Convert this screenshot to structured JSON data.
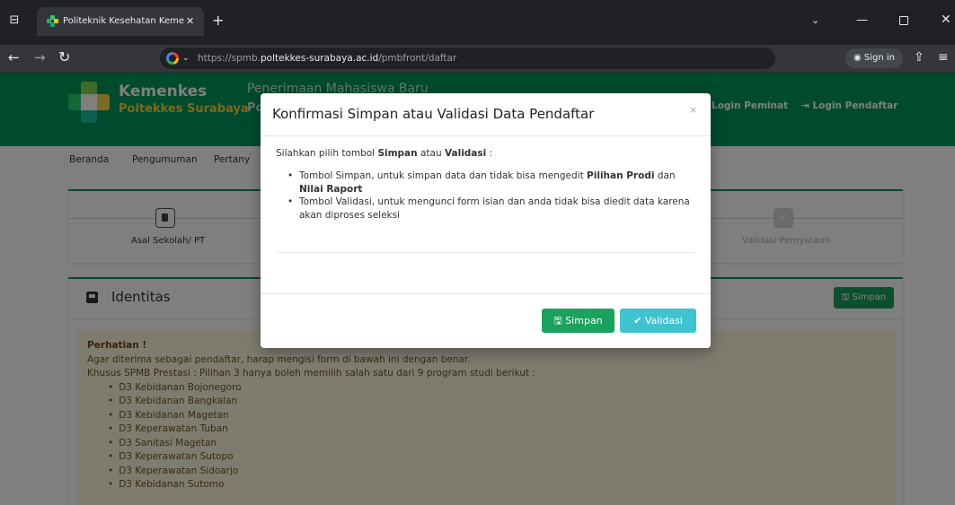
{
  "browser": {
    "tab_title": "Politeknik Kesehatan Kemenkes",
    "tab_close": "✕",
    "new_tab": "+",
    "url_prefix": "https://spmb.",
    "url_domain": "poltekkes-surabaya.ac.id",
    "url_path": "/pmbfront/daftar",
    "signin_label": "Sign in",
    "icons": [
      "tab-search-icon",
      "favicon-icon",
      "close-icon",
      "plus-icon",
      "chevron-down-icon",
      "minimize-icon",
      "maximize-icon",
      "close-window-icon",
      "back-arrow-icon",
      "forward-arrow-icon",
      "reload-icon",
      "google-icon",
      "user-icon",
      "share-icon",
      "menu-icon"
    ]
  },
  "header": {
    "brand_line1": "Kemenkes",
    "brand_line2": "Poltekkes Surabaya",
    "title_line1": "Penerimaan Mahasiswa Baru",
    "title_line2": "Po",
    "login_peminat": "Login Peminat",
    "login_pendaftar": "Login Pendaftar",
    "brand_color": "#00965a"
  },
  "nav": {
    "items": [
      "Beranda",
      "Pengumuman",
      "Pertany"
    ]
  },
  "stepper": {
    "first_label": "Asal Sekolah/ PT",
    "last_label": "Validasi Pernyataan",
    "last_check": "✓"
  },
  "identity": {
    "title": "Identitas",
    "save_label": "Simpan"
  },
  "notice": {
    "title": "Perhatian !",
    "line1": "Agar diterima sebagai pendaftar, harap mengisi form di bawah ini dengan benar.",
    "line2": "Khusus SPMB Prestasi : Pilihan 3 hanya boleh memilih salah satu dari 9 program studi berikut :",
    "programs": [
      "D3 Kebidanan Bojonegoro",
      "D3 Kebidanan Bangkalan",
      "D3 Kebidanan Magetan",
      "D3 Keperawatan Tuban",
      "D3 Sanitasi Magetan",
      "D3 Keperawatan Sutopo",
      "D3 Keperawatan Sidoarjo",
      "D3 Kebidanan Sutomo"
    ]
  },
  "modal": {
    "title": "Konfirmasi Simpan atau Validasi Data Pendaftar",
    "close": "×",
    "intro_pre": "Silahkan pilih tombol ",
    "intro_simpan": "Simpan",
    "intro_mid": " atau ",
    "intro_validasi": "Validasi",
    "intro_post": " :",
    "bullet1_pre": "Tombol Simpan, untuk simpan data dan tidak bisa mengedit ",
    "bullet1_b1": "Pilihan Prodi",
    "bullet1_mid": " dan ",
    "bullet1_b2": "Nilai Raport",
    "bullet2": "Tombol Validasi, untuk mengunci form isian dan anda tidak bisa diedit data karena akan diproses seleksi",
    "btn_simpan": "Simpan",
    "btn_validasi": "Validasi",
    "btn_simpan_color": "#1aa25e",
    "btn_validasi_color": "#3ec3cf"
  }
}
